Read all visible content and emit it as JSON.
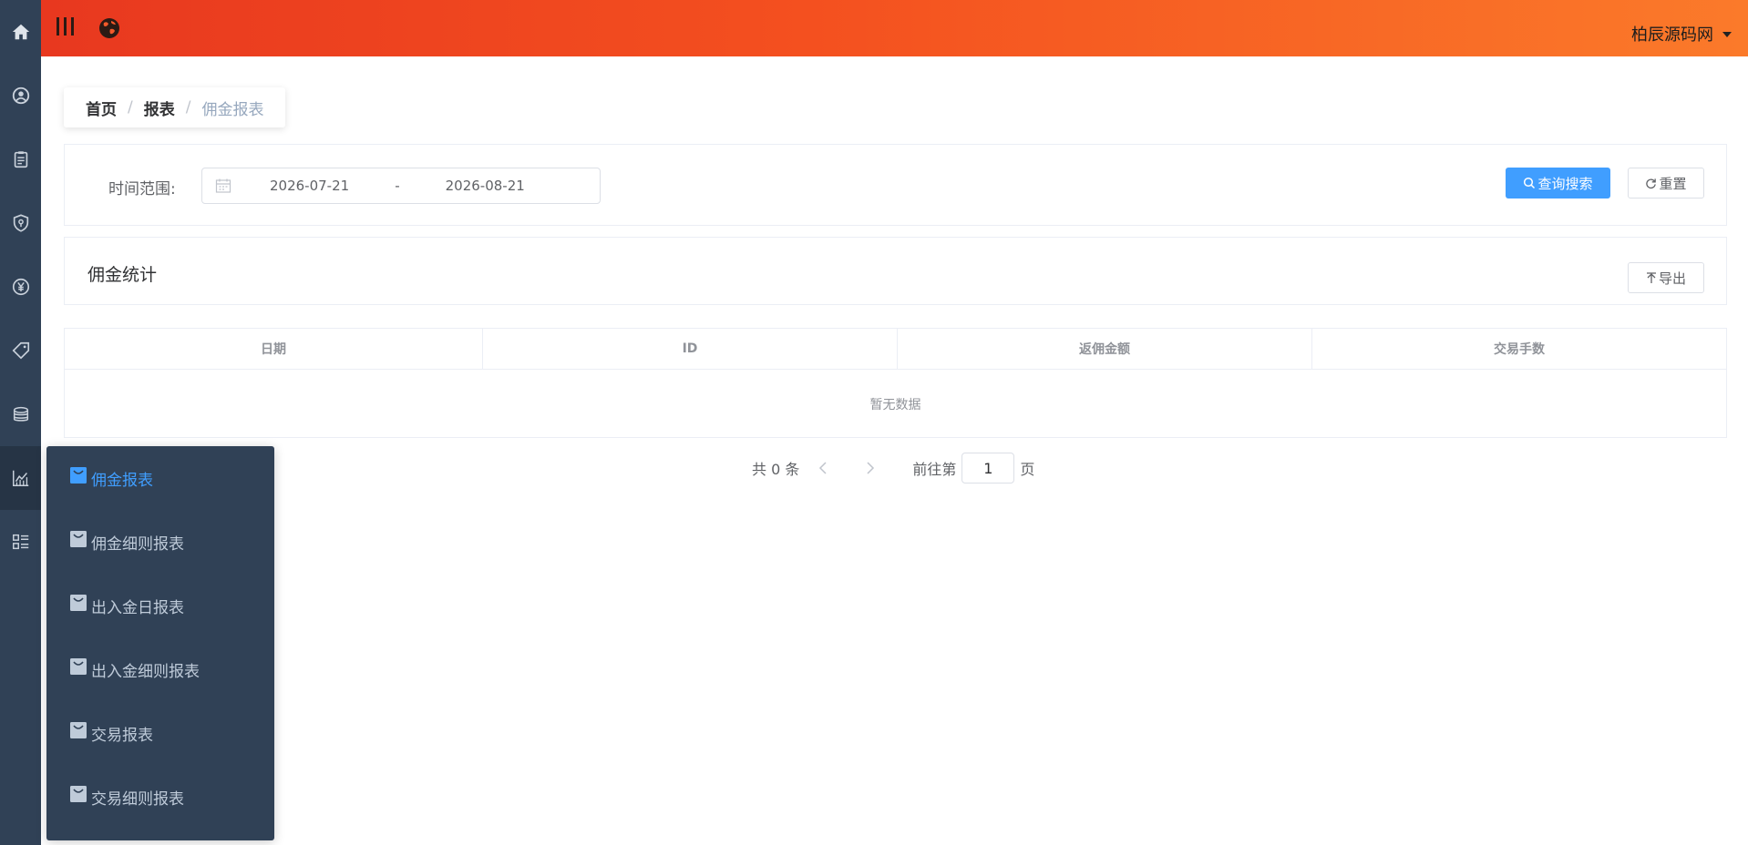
{
  "header": {
    "username": "柏辰源码网"
  },
  "breadcrumb": {
    "home": "首页",
    "separator": "/",
    "section": "报表",
    "current": "佣金报表"
  },
  "filter": {
    "label": "时间范围:",
    "start_date": "2026-07-21",
    "range_separator": "-",
    "end_date": "2026-08-21",
    "search_label": "查询搜索",
    "reset_label": "重置"
  },
  "stats": {
    "title": "佣金统计",
    "export_label": "导出"
  },
  "table": {
    "columns": [
      "日期",
      "ID",
      "返佣金额",
      "交易手数"
    ],
    "empty_text": "暂无数据"
  },
  "pagination": {
    "total_text": "共 0 条",
    "goto_prefix": "前往第",
    "current_page": "1",
    "goto_suffix": "页"
  },
  "submenu": {
    "items": [
      {
        "label": "佣金报表",
        "active": true
      },
      {
        "label": "佣金细则报表",
        "active": false
      },
      {
        "label": "出入金日报表",
        "active": false
      },
      {
        "label": "出入金细则报表",
        "active": false
      },
      {
        "label": "交易报表",
        "active": false
      },
      {
        "label": "交易细则报表",
        "active": false
      }
    ]
  },
  "colors": {
    "rail_bg": "#304156",
    "accent": "#409eff",
    "topbar_start": "#e8381f",
    "topbar_end": "#fb7a2a"
  },
  "icons": {
    "rail": [
      "home-icon",
      "user-circle-icon",
      "clipboard-icon",
      "shield-icon",
      "yen-icon",
      "tag-icon",
      "coins-icon",
      "chart-line-icon",
      "list-icon"
    ],
    "topbar": [
      "hamburger-icon",
      "globe-icon"
    ]
  }
}
